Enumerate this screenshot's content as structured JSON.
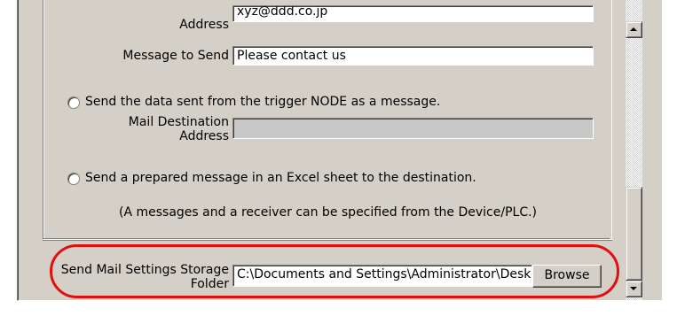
{
  "email": {
    "address_label": "Address",
    "address_value": "xyz@ddd.co.jp",
    "message_label": "Message to Send",
    "message_value": "Please contact us"
  },
  "option_node": {
    "label": "Send the data sent from the trigger NODE as a message.",
    "dest_label_line1": "Mail Destination",
    "dest_label_line2": "Address",
    "dest_value": ""
  },
  "option_excel": {
    "label": "Send a prepared message in an Excel sheet to the destination.",
    "note": "(A messages and a receiver can be specified from the Device/PLC.)"
  },
  "storage": {
    "label_line1": "Send Mail Settings Storage",
    "label_line2": "Folder",
    "path_value": "C:\\Documents and Settings\\Administrator\\Desk",
    "browse_label": "Browse"
  },
  "colors": {
    "highlight": "#e01010",
    "face": "#d4d0c8"
  },
  "icons": {
    "scroll_up": "triangle-up-icon",
    "scroll_down": "triangle-down-icon"
  }
}
